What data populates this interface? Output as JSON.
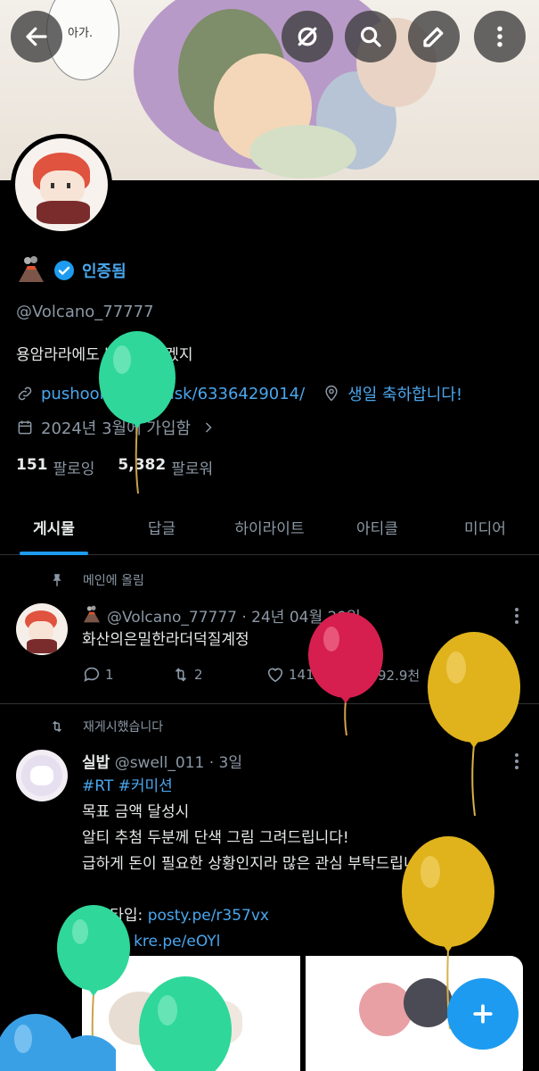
{
  "banner": {
    "speech_text": "아가."
  },
  "top_bar": {
    "back_icon": "back-arrow-icon",
    "icons": [
      "mute-icon",
      "search-icon",
      "edit-icon",
      "more-vertical-icon"
    ]
  },
  "profile": {
    "emoji_icon": "volcano-icon",
    "verified_label": "인증됨",
    "handle": "@Volcano_77777",
    "bio": "용암라라에도 밥집은 있겠지",
    "link": "pushoong.com/ask/6336429014/",
    "location": "생일 축하합니다!",
    "joined": "2024년 3월에 가입함",
    "following_count": "151",
    "following_label": "팔로잉",
    "followers_count": "5,382",
    "followers_label": "팔로워"
  },
  "tabs": [
    {
      "label": "게시물",
      "active": true
    },
    {
      "label": "답글",
      "active": false
    },
    {
      "label": "하이라이트",
      "active": false
    },
    {
      "label": "아티클",
      "active": false
    },
    {
      "label": "미디어",
      "active": false
    }
  ],
  "pinned_post": {
    "pin_label": "메인에 올림",
    "handle": "@Volcano_77777",
    "date": "· 24년 04월 29일",
    "text": "화산의은밀한라더덕질계정",
    "replies": "1",
    "reposts": "2",
    "likes": "141",
    "views": "92.9천"
  },
  "repost": {
    "repost_label": "재게시했습니다",
    "name": "실밥",
    "handle": "@swell_011",
    "time": "· 3일",
    "hashtags": "#RT #커미션",
    "lines": [
      "목표 금액 달성시",
      "알티 추첨 두분께 단색 그림 그려드립니다!",
      "급하게 돈이 필요한 상황인지라 많은 관심 부탁드립니다."
    ],
    "posty_label": "포스타입: ",
    "posty_link": "posty.pe/r357vx",
    "kre_label": "크레페: ",
    "kre_link": "kre.pe/eOYl"
  },
  "fab_label": "+",
  "colors": {
    "accent": "#1d9bf0",
    "link": "#4aa7ee",
    "muted": "#8b98a5",
    "background": "#000000"
  }
}
